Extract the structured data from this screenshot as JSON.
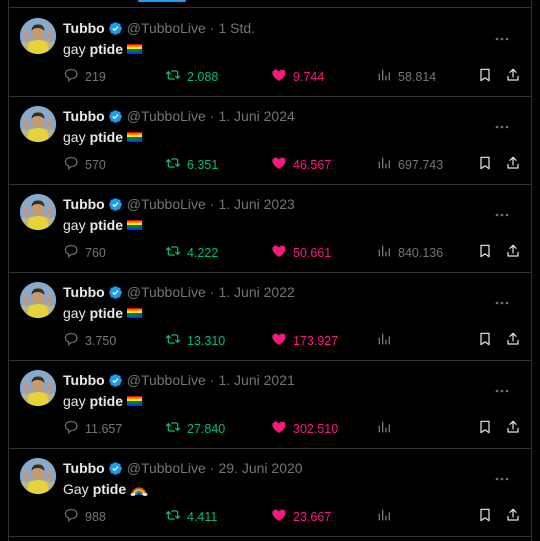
{
  "colors": {
    "accent": "#1d9bf0",
    "retweet": "#00ba7c",
    "like": "#f91880",
    "muted": "#71767b"
  },
  "icons": [
    "verified-badge-icon",
    "more-icon",
    "reply-icon",
    "retweet-icon",
    "like-icon",
    "views-icon",
    "bookmark-icon",
    "share-icon",
    "pride-flag-icon",
    "rainbow-icon"
  ],
  "tweets": [
    {
      "name": "Tubbo",
      "handle": "@TubboLive",
      "sep": "·",
      "time": "1 Std.",
      "text_a": "gay",
      "text_b": "ptide",
      "emoji": "flag",
      "replies": "219",
      "retweets": "2.088",
      "likes": "9.744",
      "views": "58.814"
    },
    {
      "name": "Tubbo",
      "handle": "@TubboLive",
      "sep": "·",
      "time": "1. Juni 2024",
      "text_a": "gay",
      "text_b": "ptide",
      "emoji": "flag",
      "replies": "570",
      "retweets": "6.351",
      "likes": "46.567",
      "views": "697.743"
    },
    {
      "name": "Tubbo",
      "handle": "@TubboLive",
      "sep": "·",
      "time": "1. Juni 2023",
      "text_a": "gay",
      "text_b": "ptide",
      "emoji": "flag",
      "replies": "760",
      "retweets": "4.222",
      "likes": "50.661",
      "views": "840.136"
    },
    {
      "name": "Tubbo",
      "handle": "@TubboLive",
      "sep": "·",
      "time": "1. Juni 2022",
      "text_a": "gay",
      "text_b": "ptide",
      "emoji": "flag",
      "replies": "3.750",
      "retweets": "13.310",
      "likes": "173.927",
      "views": ""
    },
    {
      "name": "Tubbo",
      "handle": "@TubboLive",
      "sep": "·",
      "time": "1. Juni 2021",
      "text_a": "gay",
      "text_b": "ptide",
      "emoji": "flag",
      "replies": "11.657",
      "retweets": "27.840",
      "likes": "302.510",
      "views": ""
    },
    {
      "name": "Tubbo",
      "handle": "@TubboLive",
      "sep": "·",
      "time": "29. Juni 2020",
      "text_a": "Gay",
      "text_b": "ptide",
      "emoji": "rainbow",
      "replies": "988",
      "retweets": "4.411",
      "likes": "23.667",
      "views": ""
    }
  ]
}
